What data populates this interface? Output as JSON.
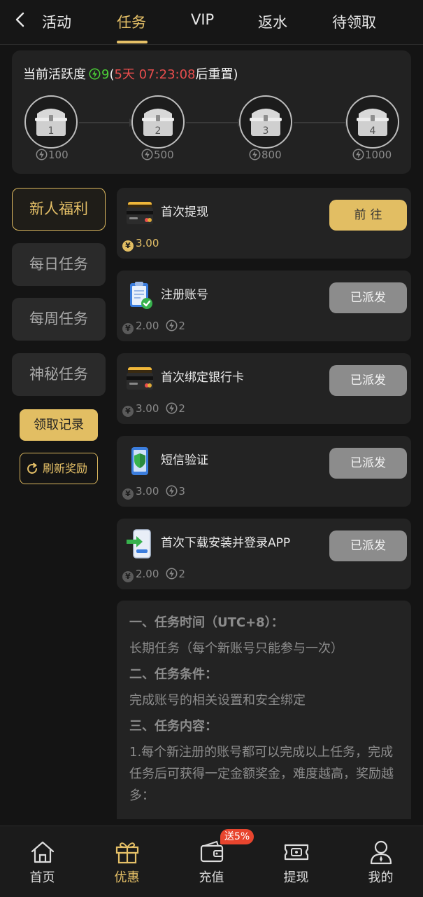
{
  "colors": {
    "background": "#141414",
    "card": "#232323",
    "accent_gold": "#e5c067",
    "active_green": "#4cd137",
    "countdown_red": "#e84d4d",
    "disabled_button": "#8c8c8c"
  },
  "topbar": {
    "back_icon": "chevron-left-icon",
    "tabs": [
      {
        "label": "活动",
        "active": false
      },
      {
        "label": "任务",
        "active": true
      },
      {
        "label": "VIP",
        "active": false
      },
      {
        "label": "返水",
        "active": false
      },
      {
        "label": "待领取",
        "active": false
      }
    ]
  },
  "activity": {
    "label": "当前活跃度",
    "value": "9",
    "reset_open": "(",
    "countdown": "5天 07:23:08",
    "reset_suffix": "后重置)",
    "chests": [
      {
        "number": "1",
        "cost": "100"
      },
      {
        "number": "2",
        "cost": "500"
      },
      {
        "number": "3",
        "cost": "800"
      },
      {
        "number": "4",
        "cost": "1000"
      }
    ]
  },
  "sidebar": {
    "items": [
      {
        "label": "新人福利",
        "active": true
      },
      {
        "label": "每日任务",
        "active": false
      },
      {
        "label": "每周任务",
        "active": false
      },
      {
        "label": "神秘任务",
        "active": false
      }
    ],
    "records_label": "领取记录",
    "refresh_label": "刷新奖励"
  },
  "tasks": [
    {
      "title": "首次提现",
      "icon": "bank-card-icon",
      "button": "前往",
      "button_state": "go",
      "reward_money": "3.00",
      "reward_activity": ""
    },
    {
      "title": "注册账号",
      "icon": "clipboard-check-icon",
      "button": "已派发",
      "button_state": "done",
      "reward_money": "2.00",
      "reward_activity": "2"
    },
    {
      "title": "首次绑定银行卡",
      "icon": "bank-card-icon",
      "button": "已派发",
      "button_state": "done",
      "reward_money": "3.00",
      "reward_activity": "2"
    },
    {
      "title": "短信验证",
      "icon": "phone-shield-icon",
      "button": "已派发",
      "button_state": "done",
      "reward_money": "3.00",
      "reward_activity": "3"
    },
    {
      "title": "首次下载安装并登录APP",
      "icon": "phone-download-icon",
      "button": "已派发",
      "button_state": "done",
      "reward_money": "2.00",
      "reward_activity": "2"
    }
  ],
  "currency_symbol": "¥",
  "rules": {
    "h1": "一、任务时间（UTC+8）：",
    "p1": "长期任务（每个新账号只能参与一次）",
    "h2": "二、任务条件：",
    "p2": "完成账号的相关设置和安全绑定",
    "h3": "三、任务内容：",
    "p3": "1.每个新注册的账号都可以完成以上任务，完成任务后可获得一定金额奖金，难度越高，奖励越多："
  },
  "bottom_nav": {
    "items": [
      {
        "label": "首页",
        "icon": "home-icon",
        "active": false
      },
      {
        "label": "优惠",
        "icon": "gift-icon",
        "active": true
      },
      {
        "label": "充值",
        "icon": "wallet-icon",
        "active": false
      },
      {
        "label": "提现",
        "icon": "withdraw-ticket-icon",
        "active": false
      },
      {
        "label": "我的",
        "icon": "user-icon",
        "active": false
      }
    ],
    "promo_badge": "送5%"
  }
}
